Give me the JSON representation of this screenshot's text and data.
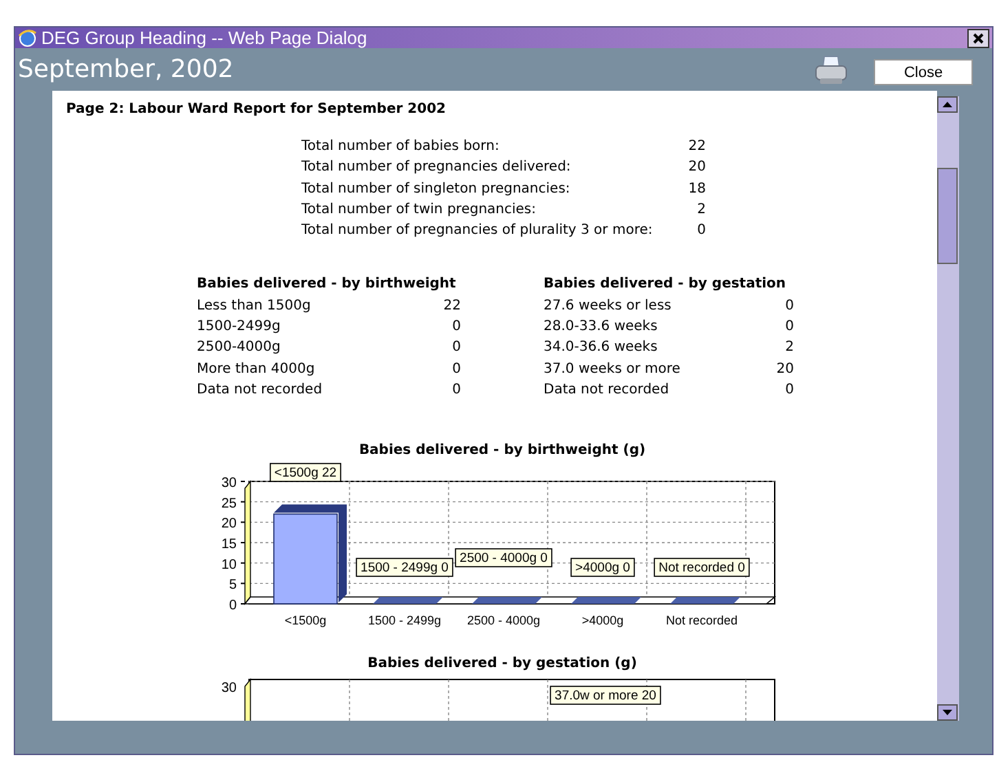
{
  "window": {
    "title": "DEG Group Heading -- Web Page Dialog"
  },
  "header": {
    "title": "September, 2002",
    "buttons": [
      "Close"
    ]
  },
  "report": {
    "heading": "Page 2: Labour Ward Report for September 2002",
    "totals": [
      {
        "label": "Total number of babies born:",
        "value": "22"
      },
      {
        "label": "Total number of pregnancies delivered:",
        "value": "20"
      },
      {
        "label": "Total number of singleton pregnancies:",
        "value": "18"
      },
      {
        "label": "Total number of twin pregnancies:",
        "value": "2"
      },
      {
        "label": "Total number of pregnancies of plurality 3 or more:",
        "value": "0"
      }
    ],
    "tables": [
      {
        "heading": "Babies delivered - by birthweight",
        "rows": [
          {
            "label": "Less than 1500g",
            "value": "22"
          },
          {
            "label": "1500-2499g",
            "value": "0"
          },
          {
            "label": "2500-4000g",
            "value": "0"
          },
          {
            "label": "More than 4000g",
            "value": "0"
          },
          {
            "label": "Data not recorded",
            "value": "0"
          }
        ]
      },
      {
        "heading": "Babies delivered - by gestation",
        "rows": [
          {
            "label": "27.6 weeks or less",
            "value": "0"
          },
          {
            "label": "28.0-33.6 weeks",
            "value": "0"
          },
          {
            "label": "34.0-36.6 weeks",
            "value": "2"
          },
          {
            "label": "37.0 weeks or more",
            "value": "20"
          },
          {
            "label": "Data not recorded",
            "value": "0"
          }
        ]
      }
    ],
    "chart": {
      "chart_data": {
        "type": "bar",
        "title": "Babies delivered - by birthweight (g)",
        "categories": [
          "<1500g",
          "1500 - 2499g",
          "2500 - 4000g",
          ">4000g",
          "Not recorded"
        ],
        "values": [
          22,
          0,
          0,
          0,
          0
        ],
        "ylim": [
          0,
          30
        ],
        "grid": true,
        "yticks": [
          0,
          5,
          10,
          15,
          20,
          25,
          30
        ],
        "value_labels": [
          "<1500g 22",
          "1500 - 2499g 0",
          "2500 - 4000g 0",
          ">4000g 0",
          "Not recorded 0"
        ]
      }
    },
    "chart_partial": {
      "title": "Babies delivered - by gestation (g)",
      "tick_label": "30",
      "data_label": "37.0w or more 20"
    }
  }
}
